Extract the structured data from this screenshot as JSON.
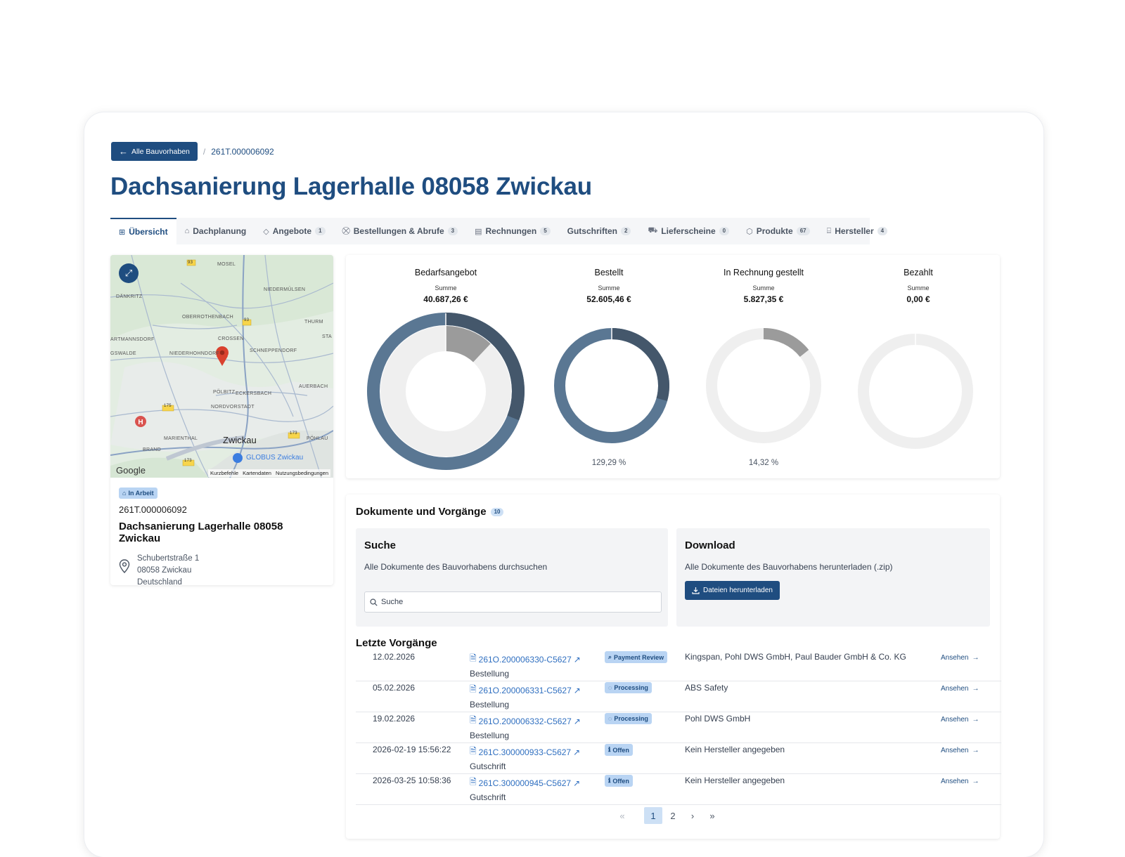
{
  "breadcrumb": {
    "back_label": "Alle Bauvorhaben",
    "separator": "/",
    "project_id": "261T.000006092"
  },
  "page_title": "Dachsanierung Lagerhalle 08058 Zwickau",
  "tabs": [
    {
      "label": "Übersicht",
      "icon": "grid-icon",
      "badge": ""
    },
    {
      "label": "Dachplanung",
      "icon": "building-icon",
      "badge": ""
    },
    {
      "label": "Angebote",
      "icon": "tag-icon",
      "badge": "1"
    },
    {
      "label": "Bestellungen & Abrufe",
      "icon": "cart-icon",
      "badge": "3"
    },
    {
      "label": "Rechnungen",
      "icon": "receipt-icon",
      "badge": "5"
    },
    {
      "label": "Gutschriften",
      "icon": "",
      "badge": "2"
    },
    {
      "label": "Lieferscheine",
      "icon": "truck-icon",
      "badge": "0"
    },
    {
      "label": "Produkte",
      "icon": "box-icon",
      "badge": "67"
    },
    {
      "label": "Hersteller",
      "icon": "factory-icon",
      "badge": "4"
    }
  ],
  "map": {
    "places": [
      "MOSEL",
      "DÄNKRITZ",
      "NIEDERMÜLSEN",
      "OBERROTHENBACH",
      "THURM",
      "CROSSEN",
      "STA",
      "ARTMANNSDORF",
      "SCHNEPPENDORF",
      "GSWALDE",
      "NIEDERHOHNDORF",
      "PÖLBITZ",
      "ECKERSBACH",
      "AUERBACH",
      "NORDVORSTADT",
      "MARIENTHAL",
      "PÖHLAU",
      "BRAND"
    ],
    "city": "Zwickau",
    "poi": "GLOBUS Zwickau",
    "road_labels": [
      "93",
      "93",
      "175",
      "173",
      "173"
    ],
    "attribution": "Google",
    "links": [
      "Kurzbefehle",
      "Kartendaten",
      "Nutzungsbedingungen"
    ]
  },
  "project": {
    "status": "In Arbeit",
    "id": "261T.000006092",
    "name": "Dachsanierung Lagerhalle 08058 Zwickau",
    "address": [
      "Schubertstraße 1",
      "08058 Zwickau",
      "Deutschland"
    ]
  },
  "stats": [
    {
      "title": "Bedarfsangebot",
      "sum_label": "Summe",
      "sum": "40.687,26 €",
      "percent": "",
      "donut": {
        "outer": [
          0.12,
          0.88
        ],
        "inner": [
          0.12,
          0.88
        ]
      }
    },
    {
      "title": "Bestellt",
      "sum_label": "Summe",
      "sum": "52.605,46 €",
      "percent": "129,29 %",
      "donut": {
        "share": 0.2929
      }
    },
    {
      "title": "In Rechnung gestellt",
      "sum_label": "Summe",
      "sum": "5.827,35 €",
      "percent": "14,32 %",
      "donut": {
        "share": 0.1432
      }
    },
    {
      "title": "Bezahlt",
      "sum_label": "Summe",
      "sum": "0,00 €",
      "percent": "",
      "donut": {
        "share": 0
      }
    }
  ],
  "colors": {
    "primary": "#1f4d80",
    "donut_dark": "#44576b",
    "donut_mid": "#5a7793",
    "donut_grey": "#9b9b9b",
    "donut_track": "#efefef"
  },
  "documents": {
    "title": "Dokumente und Vorgänge",
    "count": "10",
    "search": {
      "title": "Suche",
      "description": "Alle Dokumente des Bauvorhabens durchsuchen",
      "placeholder": "Suche"
    },
    "download": {
      "title": "Download",
      "description": "Alle Dokumente des Bauvorhabens herunterladen (.zip)",
      "button": "Dateien herunterladen"
    },
    "recent_title": "Letzte Vorgänge",
    "rows": [
      {
        "date": "12.02.2026",
        "doc": "261O.200006330-C5627",
        "type": "Bestellung",
        "status": "Payment Review",
        "status_icon": "search-icon",
        "supplier": "Kingspan, Pohl DWS GmbH, Paul Bauder GmbH & Co. KG",
        "action": "Ansehen"
      },
      {
        "date": "05.02.2026",
        "doc": "261O.200006331-C5627",
        "type": "Bestellung",
        "status": "Processing",
        "status_icon": "spinner-icon",
        "supplier": "ABS Safety",
        "action": "Ansehen"
      },
      {
        "date": "19.02.2026",
        "doc": "261O.200006332-C5627",
        "type": "Bestellung",
        "status": "Processing",
        "status_icon": "spinner-icon",
        "supplier": "Pohl DWS GmbH",
        "action": "Ansehen"
      },
      {
        "date": "2026-02-19 15:56:22",
        "doc": "261C.300000933-C5627",
        "type": "Gutschrift",
        "status": "Offen",
        "status_icon": "info-icon",
        "supplier": "Kein Hersteller angegeben",
        "action": "Ansehen"
      },
      {
        "date": "2026-03-25 10:58:36",
        "doc": "261C.300000945-C5627",
        "type": "Gutschrift",
        "status": "Offen",
        "status_icon": "info-icon",
        "supplier": "Kein Hersteller angegeben",
        "action": "Ansehen"
      }
    ],
    "pagination": {
      "first": "«",
      "pages": [
        "1",
        "2"
      ],
      "current": "1",
      "next": "›",
      "last": "»"
    }
  }
}
